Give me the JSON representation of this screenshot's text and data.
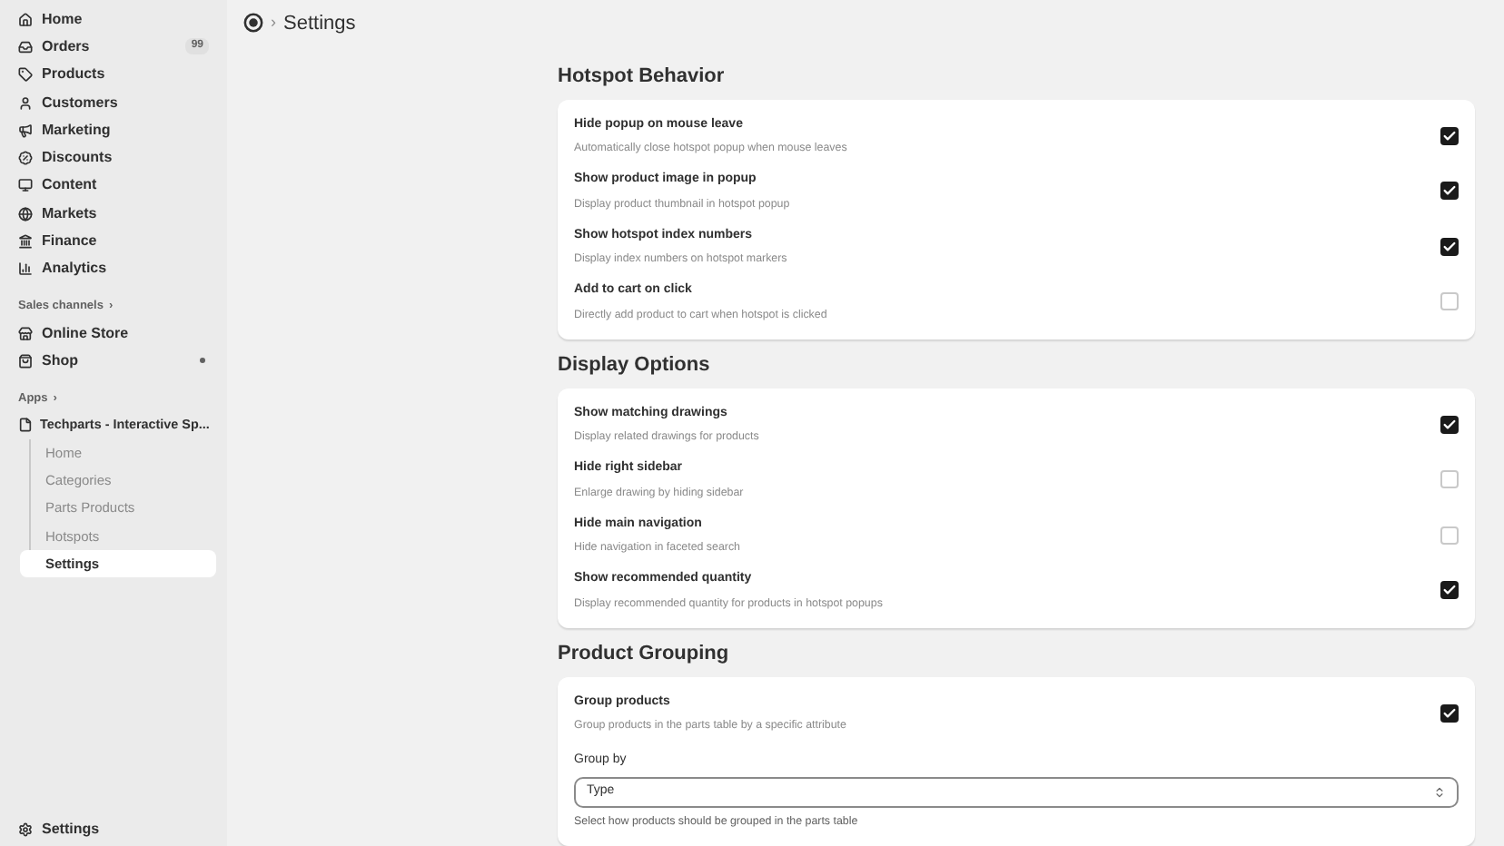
{
  "sidebar": {
    "nav": [
      {
        "label": "Home"
      },
      {
        "label": "Orders",
        "badge": "99"
      },
      {
        "label": "Products"
      },
      {
        "label": "Customers"
      },
      {
        "label": "Marketing"
      },
      {
        "label": "Discounts"
      },
      {
        "label": "Content"
      },
      {
        "label": "Markets"
      },
      {
        "label": "Finance"
      },
      {
        "label": "Analytics"
      }
    ],
    "sales_channels": {
      "title": "Sales channels",
      "chevron": "›",
      "items": [
        {
          "label": "Online Store"
        },
        {
          "label": "Shop"
        }
      ]
    },
    "apps": {
      "title": "Apps",
      "chevron": "›",
      "app": "Techparts - Interactive Sp...",
      "items": [
        {
          "label": "Home",
          "selected": false
        },
        {
          "label": "Categories",
          "selected": false
        },
        {
          "label": "Parts Products",
          "selected": false
        },
        {
          "label": "Hotspots",
          "selected": false
        },
        {
          "label": "Settings",
          "selected": true
        }
      ]
    },
    "footer": {
      "label": "Settings"
    }
  },
  "header": {
    "separator": "›",
    "title": "Settings"
  },
  "sections": [
    {
      "title": "Hotspot Behavior",
      "options": [
        {
          "kind": "checkbox",
          "label": "Hide popup on mouse leave",
          "description": "Automatically close hotspot popup when mouse leaves",
          "checked": true
        },
        {
          "kind": "checkbox",
          "label": "Show product image in popup",
          "description": "Display product thumbnail in hotspot popup",
          "checked": true
        },
        {
          "kind": "checkbox",
          "label": "Show hotspot index numbers",
          "description": "Display index numbers on hotspot markers",
          "checked": true
        },
        {
          "kind": "checkbox",
          "label": "Add to cart on click",
          "description": "Directly add product to cart when hotspot is clicked",
          "checked": false
        }
      ]
    },
    {
      "title": "Display Options",
      "options": [
        {
          "kind": "checkbox",
          "label": "Show matching drawings",
          "description": "Display related drawings for products",
          "checked": true
        },
        {
          "kind": "checkbox",
          "label": "Hide right sidebar",
          "description": "Enlarge drawing by hiding sidebar",
          "checked": false
        },
        {
          "kind": "checkbox",
          "label": "Hide main navigation",
          "description": "Hide navigation in faceted search",
          "checked": false
        },
        {
          "kind": "checkbox",
          "label": "Show recommended quantity",
          "description": "Display recommended quantity for products in hotspot popups",
          "checked": true
        }
      ]
    },
    {
      "title": "Product Grouping",
      "options": [
        {
          "kind": "checkbox",
          "label": "Group products",
          "description": "Group products in the parts table by a specific attribute",
          "checked": true
        },
        {
          "kind": "select",
          "label": "Group by",
          "value": "Type",
          "help": "Select how products should be grouped in the parts table"
        }
      ]
    }
  ]
}
